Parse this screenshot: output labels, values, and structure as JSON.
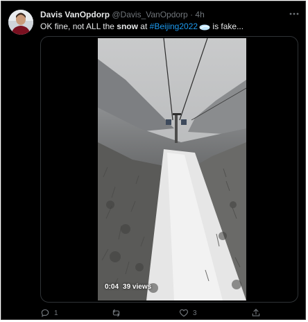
{
  "tweet": {
    "author": {
      "display_name": "Davis VanOpdorp",
      "handle": "@Davis_VanOpdorp",
      "separator": "·",
      "time": "4h"
    },
    "text": {
      "prefix": "OK fine, not ALL the ",
      "bold": "snow",
      "middle": " at ",
      "hashtag": "#Beijing2022",
      "suffix": " is fake..."
    },
    "more_icon": "more-horizontal-icon",
    "media": {
      "type": "video",
      "duration": "0:04",
      "views": "39 views"
    },
    "actions": {
      "reply_count": "1",
      "retweet_count": "",
      "like_count": "3",
      "share_count": ""
    }
  },
  "theme": {
    "background": "#000000",
    "text": "#e7e9ea",
    "muted": "#71767b",
    "link": "#1d9bf0"
  }
}
